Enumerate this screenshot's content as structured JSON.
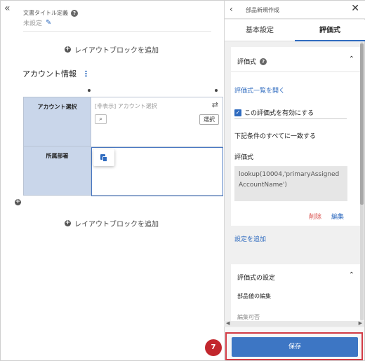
{
  "left_panel": {
    "collapse_icon": "double-chevron-left",
    "doc_title_label": "文書タイトル定義",
    "doc_title_value": "未設定",
    "add_block_label": "レイアウトブロックを追加",
    "section_title": "アカウント情報",
    "grid": {
      "row1_label": "アカウント選択",
      "row1_hidden_label": "[非表示] アカウント選択",
      "row1_select_button": "選択",
      "row2_label": "所属部署"
    }
  },
  "right_panel": {
    "header_title": "部品新規作成",
    "tabs": [
      {
        "label": "基本設定",
        "active": false
      },
      {
        "label": "評価式",
        "active": true
      }
    ],
    "formula_card": {
      "title": "評価式",
      "open_list_link": "評価式一覧を開く",
      "enable_checkbox_label": "この評価式を有効にする",
      "enable_checked": true,
      "condition_text": "下記条件のすべてに一致する",
      "expression_label": "評価式",
      "expression_value": "lookup(10004,'primaryAssignedAccountName')",
      "delete_label": "削除",
      "edit_label": "編集"
    },
    "add_setting_link": "設定を追加",
    "formula_settings_card": {
      "title": "評価式の設定",
      "subtitle": "部品値の編集",
      "partial_text": "編集可否"
    },
    "save_button": "保存"
  },
  "step_badge": "7",
  "colors": {
    "accent": "#2f6bbf",
    "save_button": "#3d76c4",
    "highlight_border": "#d23b45",
    "badge": "#c2272d",
    "delete": "#d9534f",
    "grid_label_bg": "#c9d6ea"
  }
}
